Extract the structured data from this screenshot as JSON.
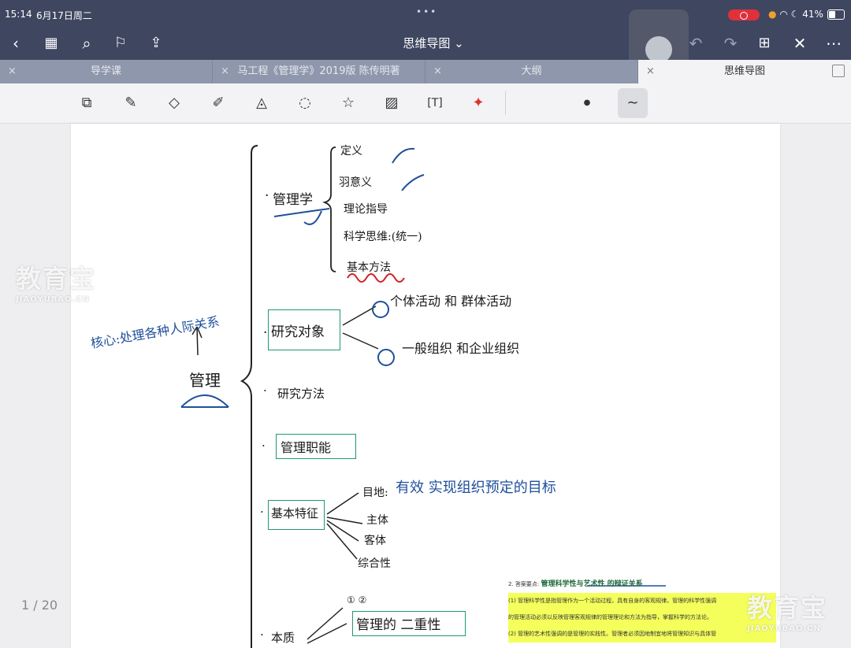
{
  "status": {
    "time": "15:14",
    "date": "6月17日周二",
    "battery": "41%"
  },
  "nav": {
    "title": "思维导图 ⌄"
  },
  "tabs": [
    {
      "label": "导学课",
      "active": false
    },
    {
      "label": "马工程《管理学》2019版 陈传明著",
      "active": false
    },
    {
      "label": "大纲",
      "active": false
    },
    {
      "label": "思维导图",
      "active": true
    }
  ],
  "toolbar": {
    "icons": [
      "lasso-select-icon",
      "pen-icon",
      "eraser-icon",
      "highlighter-icon",
      "shapes-icon",
      "lasso-icon",
      "sticker-icon",
      "image-icon",
      "text-icon",
      "laser-pointer-icon"
    ]
  },
  "page": {
    "indicator": "1 / 20"
  },
  "watermark": {
    "brand": "教育宝",
    "domain": "JIAOYUBAO.CN"
  },
  "mindmap": {
    "root": "管理",
    "core_note": "核心:处理各种人际关系",
    "branch1": "管理学",
    "branch1_items": [
      "定义",
      "羽意义",
      "理论指导",
      "科学思维:(统一)",
      "基本方法"
    ],
    "branch2": "研究对象",
    "branch2_items": [
      "个体活动 和 群体活动",
      "一般组织 和企业组织"
    ],
    "branch3": "研究方法",
    "branch4": "管理职能",
    "branch5": "基本特征",
    "branch5_items": [
      "目地:",
      "有效 实现组织预定的目标",
      "主体",
      "客体",
      "综合性"
    ],
    "branch6": "本质",
    "branch6_nums": "① ②",
    "branch6_item": "管理的 二重性"
  },
  "excerpt": {
    "heading": "2. 答案要点:",
    "heading_note": "管理科学性与艺术性 的辩证关系",
    "p1": "(1) 管理科学性是指管理作为一个活动过程，具有自身的客观规律。管理的科学性强调",
    "p1b": "的管理活动必须以反映管理客观规律的管理理论和方法为指导，掌握科学的方法论。",
    "p2": "(2) 管理的艺术性强调的是管理的实践性。管理者必须因地制宜地将管理知识与具体管"
  }
}
